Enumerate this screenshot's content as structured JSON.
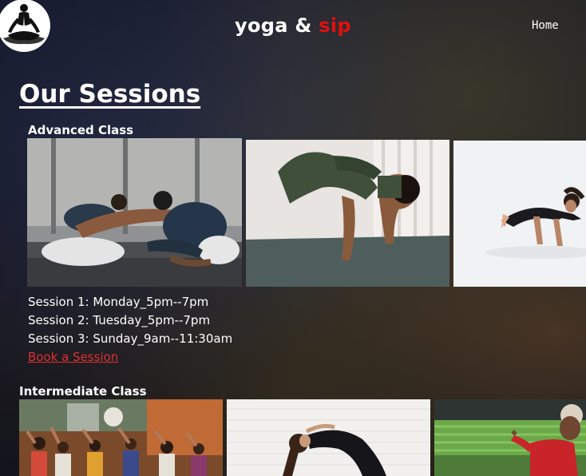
{
  "header": {
    "brand_word1": "yoga",
    "brand_amp": "&",
    "brand_word2": "sip",
    "nav_home": "Home",
    "logo_icon": "meditation-logo-icon"
  },
  "page": {
    "title": "Our Sessions"
  },
  "advanced": {
    "heading": "Advanced Class",
    "sessions": [
      "Session 1: Monday_5pm--7pm",
      "Session 2: Tuesday_5pm--7pm",
      "Session 3: Sunday_9am--11:30am"
    ],
    "book_label": "Book a Session"
  },
  "intermediate": {
    "heading": "Intermediate Class"
  },
  "colors": {
    "brand_accent": "#e01010",
    "link": "#e03030",
    "text": "#ffffff"
  }
}
